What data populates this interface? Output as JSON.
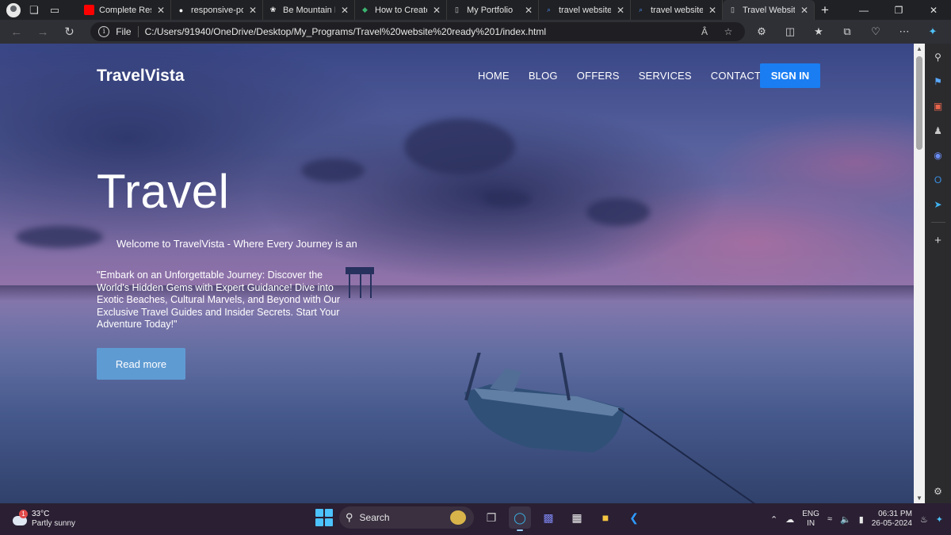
{
  "browser": {
    "tabs": [
      {
        "label": "Complete Resp",
        "favicon": "youtube-icon",
        "color": "#ff0000"
      },
      {
        "label": "responsive-port",
        "favicon": "github-icon",
        "color": "#ffffff"
      },
      {
        "label": "Be Mountain Re",
        "favicon": "chatgpt-icon",
        "color": "#ffffff"
      },
      {
        "label": "How to Create",
        "favicon": "site-icon",
        "color": "#3cb371"
      },
      {
        "label": "My Portfolio",
        "favicon": "page-icon",
        "color": "#cccccc"
      },
      {
        "label": "travel websites",
        "favicon": "search-icon",
        "color": "#4b8ef7"
      },
      {
        "label": "travel websites",
        "favicon": "search-icon",
        "color": "#4b8ef7"
      },
      {
        "label": "Travel Website",
        "favicon": "page-icon",
        "color": "#cccccc",
        "active": true
      }
    ],
    "address": {
      "scheme_label": "File",
      "url": "C:/Users/91940/OneDrive/Desktop/My_Programs/Travel%20website%20ready%201/index.html"
    }
  },
  "site": {
    "logo": "TravelVista",
    "menu": [
      "HOME",
      "BLOG",
      "OFFERS",
      "SERVICES",
      "CONTACTS"
    ],
    "signin_label": "SIGN IN",
    "hero": {
      "title": "Travel",
      "welcome": "Welcome to TravelVista - Where Every Journey is an",
      "text": "\"Embark on an Unforgettable Journey: Discover the World's Hidden Gems with Expert Guidance! Dive into Exotic Beaches, Cultural Marvels, and Beyond with Our Exclusive Travel Guides and Insider Secrets. Start Your Adventure Today!\"",
      "button": "Read more"
    },
    "colors": {
      "signin": "#1a7ef2",
      "read_more": "#5f9bd3"
    }
  },
  "taskbar": {
    "weather": {
      "temp": "33°C",
      "desc": "Partly sunny",
      "badge": "1"
    },
    "search_placeholder": "Search",
    "lang": {
      "line1": "ENG",
      "line2": "IN"
    },
    "clock": {
      "time": "06:31 PM",
      "date": "26-05-2024"
    }
  }
}
